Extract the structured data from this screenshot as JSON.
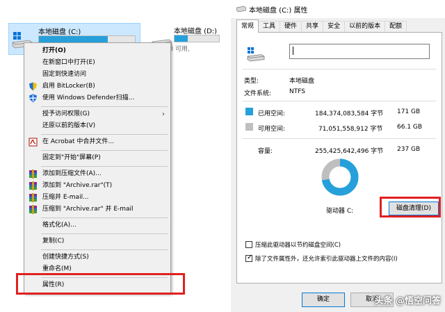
{
  "explorer": {
    "drive_c": {
      "name": "本地磁盘 (C:)",
      "used_fraction": 0.72
    },
    "drive_d": {
      "name": "本地磁盘 (D:)",
      "free_text": "113 GB 可用,",
      "used_fraction": 0.3
    }
  },
  "context_menu": {
    "items": [
      {
        "label": "打开(O)",
        "bold": true
      },
      {
        "label": "在新窗口中打开(E)"
      },
      {
        "label": "固定到快速访问"
      },
      {
        "label": "启用 BitLocker(B)",
        "icon": "bitlocker-shield-icon"
      },
      {
        "label": "使用 Windows Defender扫描...",
        "icon": "defender-shield-icon"
      },
      {
        "label": "授予访问权限(G)",
        "submenu": true
      },
      {
        "label": "还原以前的版本(V)"
      },
      {
        "label": "在 Acrobat 中合并文件...",
        "icon": "acrobat-icon"
      },
      {
        "label": "固定到\"开始\"屏幕(P)"
      },
      {
        "label": "添加到压缩文件(A)...",
        "icon": "winrar-icon"
      },
      {
        "label": "添加到 \"Archive.rar\"(T)",
        "icon": "winrar-icon"
      },
      {
        "label": "压缩并 E-mail...",
        "icon": "winrar-icon"
      },
      {
        "label": "压缩到 \"Archive.rar\" 并 E-mail",
        "icon": "winrar-icon"
      },
      {
        "label": "格式化(A)..."
      },
      {
        "label": "复制(C)"
      },
      {
        "label": "创建快捷方式(S)"
      },
      {
        "label": "重命名(M)"
      },
      {
        "label": "属性(R)"
      }
    ]
  },
  "dialog": {
    "title": "本地磁盘 (C:) 属性",
    "tabs": [
      "常规",
      "工具",
      "硬件",
      "共享",
      "安全",
      "以前的版本",
      "配额"
    ],
    "active_tab": "常规",
    "name_value": "",
    "type_label": "类型:",
    "type_value": "本地磁盘",
    "fs_label": "文件系统:",
    "fs_value": "NTFS",
    "used_label": "已用空间:",
    "used_bytes": "184,374,083,584 字节",
    "used_gb": "171 GB",
    "free_label": "可用空间:",
    "free_bytes": "71,051,558,912 字节",
    "free_gb": "66.1 GB",
    "capacity_label": "容量:",
    "capacity_bytes": "255,425,642,496 字节",
    "capacity_gb": "237 GB",
    "drive_label": "驱动器 C:",
    "cleanup_button": "磁盘清理(D)",
    "compress_label": "压缩此驱动器以节约磁盘空间(C)",
    "compress_checked": false,
    "index_label": "除了文件属性外，还允许索引此驱动器上文件的内容(I)",
    "index_checked": true,
    "ok_button": "确定",
    "cancel_button": "取消",
    "used_color": "#26a0da",
    "free_color": "#bfbfbf",
    "used_fraction": 0.7218
  },
  "watermark": "头条 @悟空问答"
}
